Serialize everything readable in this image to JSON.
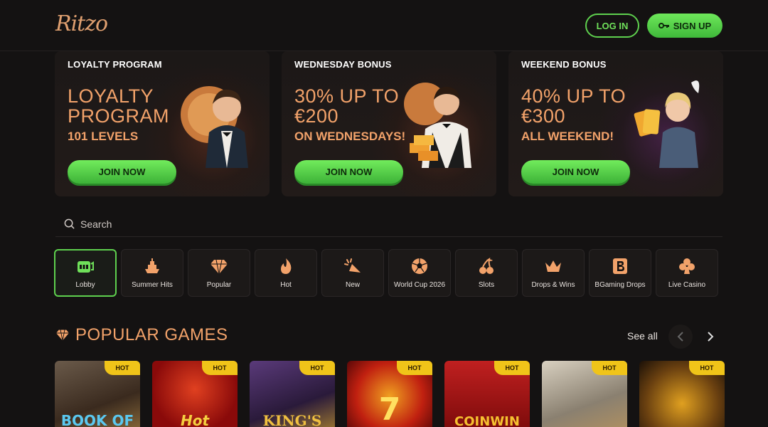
{
  "header": {
    "logo": "Ritzo",
    "login_label": "LOG IN",
    "signup_label": "SIGN UP"
  },
  "promos": [
    {
      "head": "LOYALTY PROGRAM",
      "title": "LOYALTY PROGRAM",
      "sub": "101 LEVELS",
      "button": "JOIN NOW"
    },
    {
      "head": "WEDNESDAY BONUS",
      "title": "30% UP TO €200",
      "sub": "ON WEDNESDAYS!",
      "button": "JOIN NOW"
    },
    {
      "head": "WEEKEND BONUS",
      "title": "40% UP TO €300",
      "sub": "ALL WEEKEND!",
      "button": "JOIN NOW"
    }
  ],
  "search": {
    "placeholder": "Search"
  },
  "categories": [
    {
      "label": "Lobby",
      "icon": "slot-machine-icon"
    },
    {
      "label": "Summer Hits",
      "icon": "ship-icon"
    },
    {
      "label": "Popular",
      "icon": "diamond-icon"
    },
    {
      "label": "Hot",
      "icon": "flame-icon"
    },
    {
      "label": "New",
      "icon": "sparkle-icon"
    },
    {
      "label": "World Cup 2026",
      "icon": "soccer-ball-icon"
    },
    {
      "label": "Slots",
      "icon": "cherries-icon"
    },
    {
      "label": "Drops & Wins",
      "icon": "crown-icon"
    },
    {
      "label": "BGaming Drops",
      "icon": "bgaming-icon"
    },
    {
      "label": "Live Casino",
      "icon": "club-icon"
    }
  ],
  "popular": {
    "title": "POPULAR GAMES",
    "see_all": "See all",
    "games": [
      {
        "badge": "HOT",
        "text": "BOOK OF"
      },
      {
        "badge": "HOT",
        "text": "Hot"
      },
      {
        "badge": "HOT",
        "text": "KING'S"
      },
      {
        "badge": "HOT",
        "text": "7"
      },
      {
        "badge": "HOT",
        "text": "COINWIN"
      },
      {
        "badge": "HOT",
        "text": ""
      },
      {
        "badge": "HOT",
        "text": ""
      }
    ]
  },
  "colors": {
    "accent_green": "#5ed04e",
    "accent_orange": "#f2a26a",
    "hot_badge": "#f0c419",
    "background": "#141212"
  }
}
